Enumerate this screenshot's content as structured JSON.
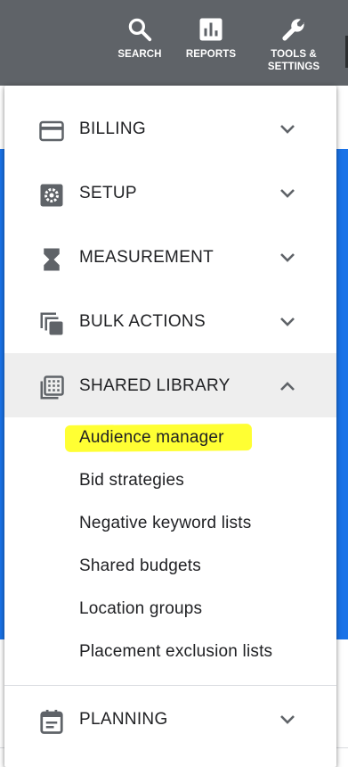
{
  "toolbar": {
    "search_label": "SEARCH",
    "reports_label": "REPORTS",
    "tools_label": "TOOLS &\nSETTINGS"
  },
  "menu": {
    "sections": [
      {
        "label": "BILLING",
        "icon": "credit-card-icon",
        "expanded": false
      },
      {
        "label": "SETUP",
        "icon": "gear-box-icon",
        "expanded": false
      },
      {
        "label": "MEASUREMENT",
        "icon": "hourglass-icon",
        "expanded": false
      },
      {
        "label": "BULK ACTIONS",
        "icon": "copy-stack-icon",
        "expanded": false
      },
      {
        "label": "SHARED LIBRARY",
        "icon": "library-grid-icon",
        "expanded": true
      },
      {
        "label": "PLANNING",
        "icon": "calendar-note-icon",
        "expanded": false
      }
    ],
    "shared_library_items": [
      "Audience manager",
      "Bid strategies",
      "Negative keyword lists",
      "Shared budgets",
      "Location groups",
      "Placement exclusion lists"
    ]
  },
  "colors": {
    "topbar": "#5f6368",
    "accent_blue": "#1a73e8",
    "highlight": "#ffff33",
    "icon_gray": "#5f6368",
    "expanded_bg": "#eeeeee"
  }
}
